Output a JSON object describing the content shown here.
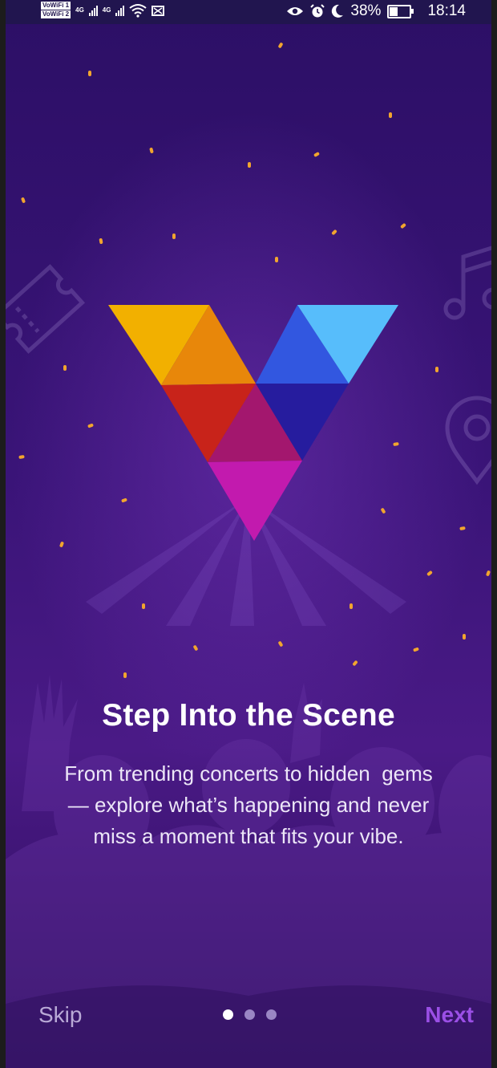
{
  "status_bar": {
    "wifi_tags": [
      "VoWiFi 1",
      "VoWiFi 2"
    ],
    "network_1": "4G",
    "network_2": "4G",
    "battery_percent": "38%",
    "battery_level": 0.38,
    "time": "18:14",
    "icons": [
      "signal-icon",
      "wifi-icon",
      "mute-icon",
      "eye-icon",
      "alarm-icon",
      "moon-icon",
      "battery-icon"
    ]
  },
  "onboarding": {
    "logo": "v-logo",
    "title": "Step Into the Scene",
    "description_lines": [
      "From trending concerts to hidden  gems",
      "— explore what’s happening and never",
      "miss a moment that fits your vibe."
    ],
    "page_count": 3,
    "active_page": 1
  },
  "nav": {
    "skip_label": "Skip",
    "next_label": "Next"
  },
  "colors": {
    "background_top": "#2c0f66",
    "background_mid": "#4a1a86",
    "confetti": "#f2a52e",
    "next_accent": "#9b4fe6",
    "skip_text": "#b9a9d6",
    "logo_yellow": "#f2b000",
    "logo_orange": "#e8870a",
    "logo_red": "#c8231a",
    "logo_magenta": "#c21aae",
    "logo_blue": "#3257e0",
    "logo_light_blue": "#57bdfb",
    "logo_navy": "#261c9e"
  },
  "decorations": [
    "ticket-icon",
    "music-note-icon",
    "location-pin-icon",
    "crowd-silhouette"
  ]
}
